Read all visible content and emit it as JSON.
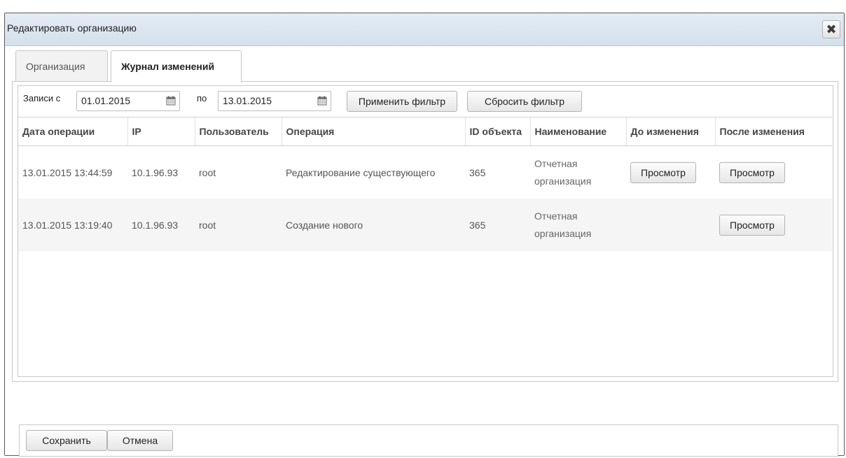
{
  "window": {
    "title": "Редактировать организацию"
  },
  "icons": {
    "close": "close-icon",
    "calendar": "calendar-icon"
  },
  "tabs": [
    {
      "label": "Организация",
      "active": false
    },
    {
      "label": "Журнал изменений",
      "active": true
    }
  ],
  "filter": {
    "from_label": "Записи с",
    "from_value": "01.01.2015",
    "to_label": "по",
    "to_value": "13.01.2015",
    "apply_label": "Применить фильтр",
    "reset_label": "Сбросить фильтр"
  },
  "table": {
    "columns": [
      "Дата операции",
      "IP",
      "Пользователь",
      "Операция",
      "ID объекта",
      "Наименование",
      "До изменения",
      "После изменения"
    ],
    "rows": [
      {
        "date": "13.01.2015 13:44:59",
        "ip": "10.1.96.93",
        "user": "root",
        "operation": "Редактирование существующего",
        "object_id": "365",
        "name_line1": "Отчетная",
        "name_line2": "организация",
        "before": "Просмотр",
        "after": "Просмотр"
      },
      {
        "date": "13.01.2015 13:19:40",
        "ip": "10.1.96.93",
        "user": "root",
        "operation": "Создание нового",
        "object_id": "365",
        "name_line1": "Отчетная",
        "name_line2": "организация",
        "before": "",
        "after": "Просмотр"
      }
    ]
  },
  "footer": {
    "save_label": "Сохранить",
    "cancel_label": "Отмена"
  },
  "colors": {
    "titlebar": "#d9e5f0",
    "alt_row": "#f5f5f5",
    "border": "#c8c8c8"
  }
}
